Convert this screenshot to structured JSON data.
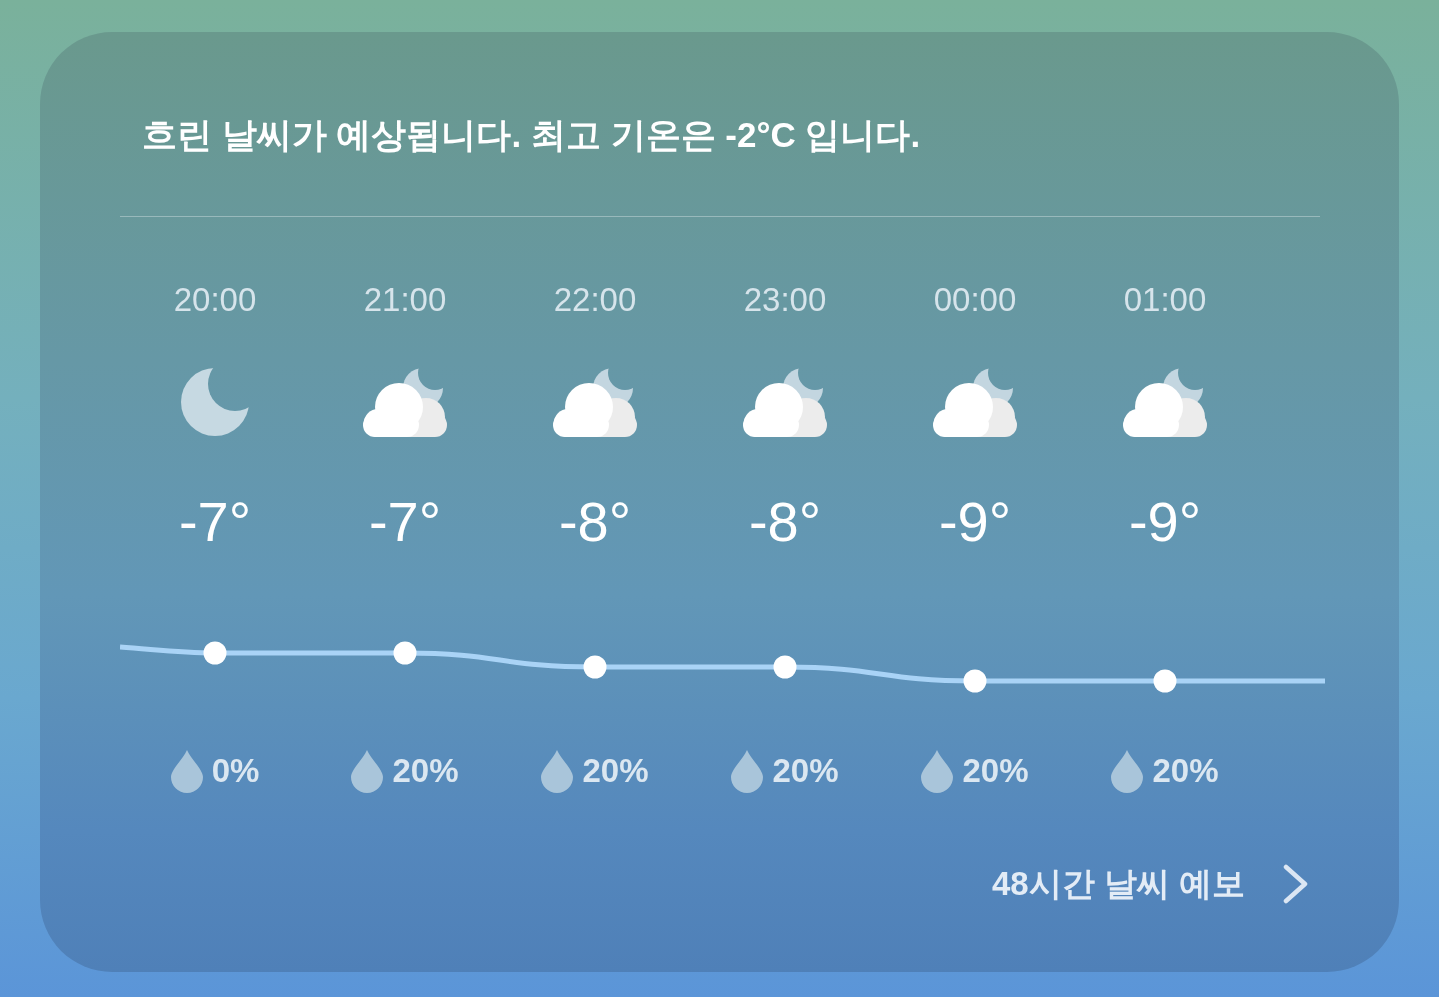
{
  "summary": "흐린 날씨가 예상됩니다. 최고 기온은 -2°C 입니다.",
  "hourly": [
    {
      "time": "20:00",
      "kind": "clear",
      "temp": "-7°",
      "precip": "0%"
    },
    {
      "time": "21:00",
      "kind": "cloudy",
      "temp": "-7°",
      "precip": "20%"
    },
    {
      "time": "22:00",
      "kind": "cloudy",
      "temp": "-8°",
      "precip": "20%"
    },
    {
      "time": "23:00",
      "kind": "cloudy",
      "temp": "-8°",
      "precip": "20%"
    },
    {
      "time": "00:00",
      "kind": "cloudy",
      "temp": "-9°",
      "precip": "20%"
    },
    {
      "time": "01:00",
      "kind": "cloudy",
      "temp": "-9°",
      "precip": "20%"
    }
  ],
  "forecast_link": "48시간 날씨 예보"
}
